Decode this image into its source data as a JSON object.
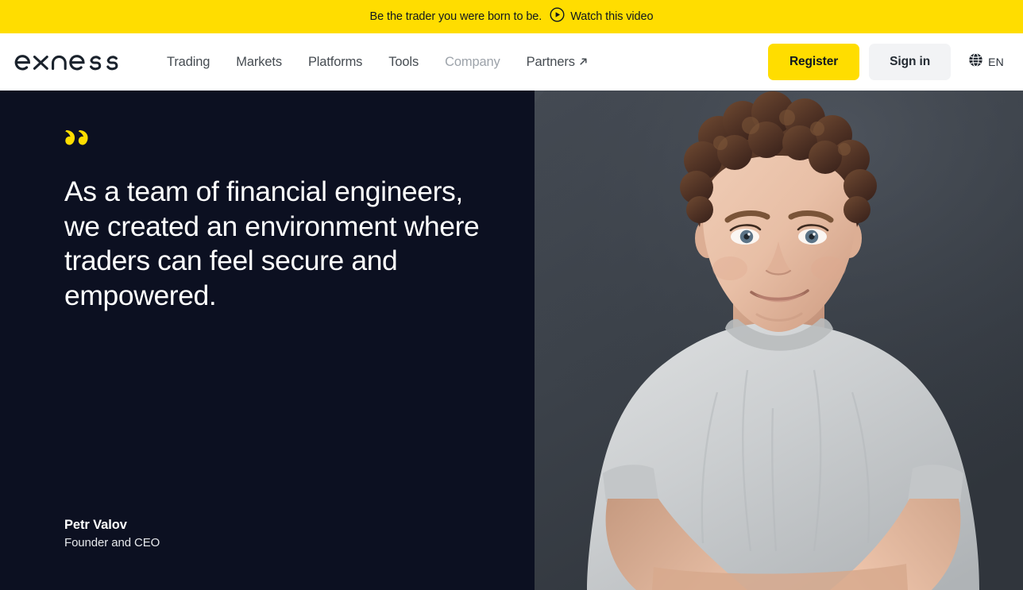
{
  "promo_banner": {
    "message": "Be the trader you were born to be.",
    "link_label": "Watch this video",
    "play_icon": "play-circle-icon",
    "background_color": "#FFDD00",
    "text_color": "#101820"
  },
  "header": {
    "logo_text": "exness",
    "logo_color": "#1A222C",
    "nav_items": [
      {
        "label": "Trading",
        "state": "default"
      },
      {
        "label": "Markets",
        "state": "default"
      },
      {
        "label": "Platforms",
        "state": "default"
      },
      {
        "label": "Tools",
        "state": "default"
      },
      {
        "label": "Company",
        "state": "dimmed"
      },
      {
        "label": "Partners",
        "state": "default",
        "icon": "external-link-arrow-icon"
      }
    ],
    "register_label": "Register",
    "signin_label": "Sign in",
    "language": {
      "code": "EN",
      "icon": "globe-icon"
    },
    "register_color": "#FFDD00",
    "signin_color": "#F2F3F5"
  },
  "hero": {
    "quote_icon": "double-quote-icon",
    "quote_icon_color": "#FFDD00",
    "quote": "As a team of financial engineers, we created an environment where traders can feel secure and empowered.",
    "author_name": "Petr Valov",
    "author_role": "Founder and CEO",
    "background_color": "#0C1021",
    "photo": {
      "description": "portrait-photo-of-founder",
      "backdrop_color": "#3B4149",
      "shirt_color": "#CDD0D2"
    }
  }
}
